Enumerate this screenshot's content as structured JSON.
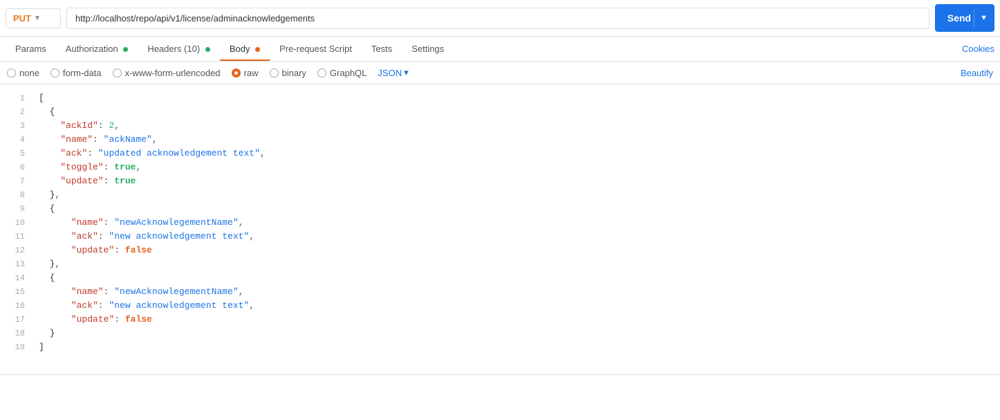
{
  "topbar": {
    "method": "PUT",
    "url": "http://localhost/repo/api/v1/license/adminacknowledgements",
    "send_label": "Send"
  },
  "tabs": [
    {
      "id": "params",
      "label": "Params",
      "dot": null
    },
    {
      "id": "authorization",
      "label": "Authorization",
      "dot": "green"
    },
    {
      "id": "headers",
      "label": "Headers (10)",
      "dot": "green"
    },
    {
      "id": "body",
      "label": "Body",
      "dot": "orange",
      "active": true
    },
    {
      "id": "pre-request-script",
      "label": "Pre-request Script",
      "dot": null
    },
    {
      "id": "tests",
      "label": "Tests",
      "dot": null
    },
    {
      "id": "settings",
      "label": "Settings",
      "dot": null
    }
  ],
  "cookies_label": "Cookies",
  "body_options": {
    "none": "none",
    "form_data": "form-data",
    "urlencoded": "x-www-form-urlencoded",
    "raw": "raw",
    "binary": "binary",
    "graphql": "GraphQL",
    "json": "JSON",
    "active": "raw"
  },
  "beautify_label": "Beautify",
  "code": {
    "lines": [
      {
        "num": 1,
        "content": "["
      },
      {
        "num": 2,
        "content": "  {"
      },
      {
        "num": 3,
        "content": "    \"ackId\": 2,"
      },
      {
        "num": 4,
        "content": "    \"name\": \"ackName\","
      },
      {
        "num": 5,
        "content": "    \"ack\": \"updated acknowledgement text\","
      },
      {
        "num": 6,
        "content": "    \"toggle\": true,"
      },
      {
        "num": 7,
        "content": "    \"update\": true"
      },
      {
        "num": 8,
        "content": "  },"
      },
      {
        "num": 9,
        "content": "  {"
      },
      {
        "num": 10,
        "content": "      \"name\": \"newAcknowlegementName\","
      },
      {
        "num": 11,
        "content": "      \"ack\": \"new acknowledgement text\","
      },
      {
        "num": 12,
        "content": "      \"update\": false"
      },
      {
        "num": 13,
        "content": "  },"
      },
      {
        "num": 14,
        "content": "  {"
      },
      {
        "num": 15,
        "content": "      \"name\": \"newAcknowlegementName\","
      },
      {
        "num": 16,
        "content": "      \"ack\": \"new acknowledgement text\","
      },
      {
        "num": 17,
        "content": "      \"update\": false"
      },
      {
        "num": 18,
        "content": "  }"
      },
      {
        "num": 19,
        "content": "]"
      }
    ]
  }
}
